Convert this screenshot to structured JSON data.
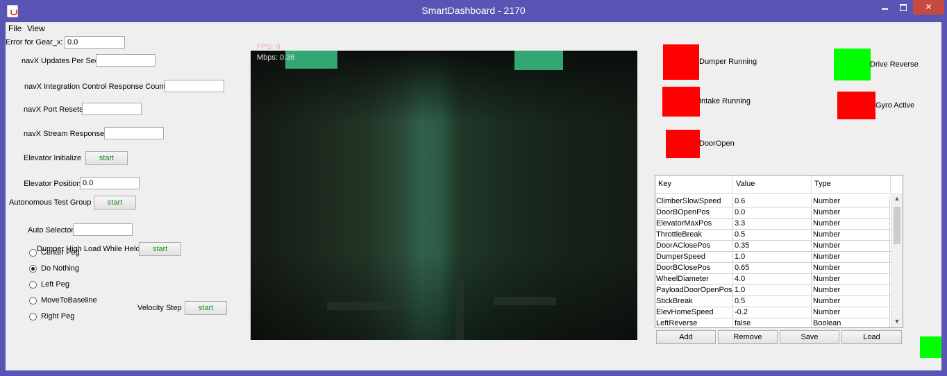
{
  "window": {
    "title": "SmartDashboard - 2170",
    "minimize": "–",
    "close": "✕"
  },
  "menu": {
    "items": [
      "File",
      "View"
    ]
  },
  "widgets": {
    "error_gear_x": {
      "label": "Error for Gear_x:",
      "value": "0.0"
    },
    "navx_updates": {
      "label": "navX Updates Per Sec",
      "value": ""
    },
    "navx_integration": {
      "label": "navX Integration Control Response Count",
      "value": ""
    },
    "navx_port_resets": {
      "label": "navX Port Resets",
      "value": ""
    },
    "navx_stream": {
      "label": "navX Stream Responses",
      "value": ""
    },
    "elevator_initialize": {
      "label": "Elevator Initialize",
      "button": "start"
    },
    "elevator_position": {
      "label": "Elevator Position",
      "value": "0.0"
    },
    "autonomous_test_group": {
      "label": "Autonomous Test Group",
      "button": "start"
    },
    "auto_selector": {
      "label": "Auto Selector",
      "value": ""
    },
    "dumper_high_load": {
      "label": "Dumper High Load While Held",
      "button": "start"
    },
    "velocity_step": {
      "label": "Velocity Step",
      "button": "start"
    }
  },
  "auto_options": [
    {
      "label": "Center Peg",
      "selected": false
    },
    {
      "label": "Do Nothing",
      "selected": true
    },
    {
      "label": "Left Peg",
      "selected": false
    },
    {
      "label": "MoveToBaseline",
      "selected": false
    },
    {
      "label": "Right Peg",
      "selected": false
    }
  ],
  "camera": {
    "fps": "FPS: 8",
    "mbps": "Mbps: 0.36"
  },
  "indicators": {
    "dumper_running": {
      "label": "Dumper Running",
      "color": "#ff0000"
    },
    "intake_running": {
      "label": "Intake Running",
      "color": "#ff0000"
    },
    "door_open": {
      "label": "DoorOpen",
      "color": "#ff0000"
    },
    "drive_reverse": {
      "label": "Drive Reverse",
      "color": "#00ff00"
    },
    "gyro_active": {
      "label": "Gyro Active",
      "color": "#ff0000"
    },
    "corner_status_color": "#00ff00"
  },
  "preferences": {
    "columns": [
      "Key",
      "Value",
      "Type"
    ],
    "rows": [
      [
        "ClimberSlowSpeed",
        "0.6",
        "Number"
      ],
      [
        "DoorBOpenPos",
        "0.0",
        "Number"
      ],
      [
        "ElevatorMaxPos",
        "3.3",
        "Number"
      ],
      [
        "ThrottleBreak",
        "0.5",
        "Number"
      ],
      [
        "DoorAClosePos",
        "0.35",
        "Number"
      ],
      [
        "DumperSpeed",
        "1.0",
        "Number"
      ],
      [
        "DoorBClosePos",
        "0.65",
        "Number"
      ],
      [
        "WheelDiameter",
        "4.0",
        "Number"
      ],
      [
        "PayloadDoorOpenPos",
        "1.0",
        "Number"
      ],
      [
        "StickBreak",
        "0.5",
        "Number"
      ],
      [
        "ElevHomeSpeed",
        "-0.2",
        "Number"
      ],
      [
        "LeftReverse",
        "false",
        "Boolean"
      ]
    ],
    "buttons": {
      "add": "Add",
      "remove": "Remove",
      "save": "Save",
      "load": "Load"
    }
  }
}
